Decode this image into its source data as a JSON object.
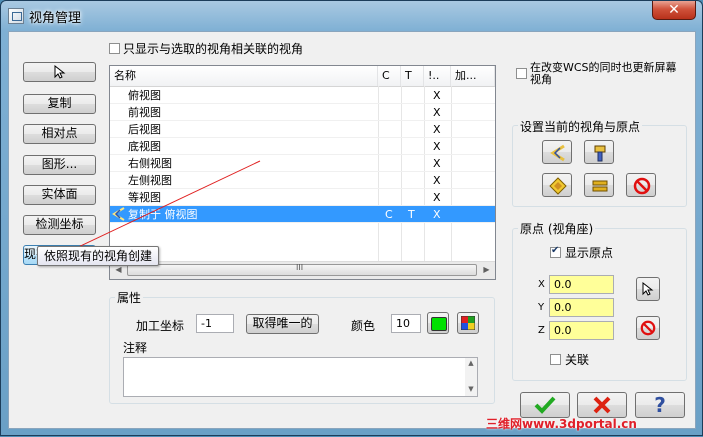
{
  "window": {
    "title": "视角管理",
    "close_label": "✕"
  },
  "left_buttons": [
    {
      "label": ""
    },
    {
      "label": "复制"
    },
    {
      "label": "相对点"
    },
    {
      "label": "图形..."
    },
    {
      "label": "实体面"
    },
    {
      "label": "检测坐标"
    },
    {
      "label": "现有的视角创"
    }
  ],
  "tooltip": "依照现有的视角创建",
  "filter_checkbox": {
    "label": "只显示与选取的视角相关联的视角",
    "checked": false
  },
  "list": {
    "headers": [
      "名称",
      "C",
      "T",
      "!..",
      "加..."
    ],
    "rows": [
      {
        "name": "俯视图",
        "c": "",
        "t": "",
        "x": "X",
        "selected": false
      },
      {
        "name": "前视图",
        "c": "",
        "t": "",
        "x": "X",
        "selected": false
      },
      {
        "name": "后视图",
        "c": "",
        "t": "",
        "x": "X",
        "selected": false
      },
      {
        "name": "底视图",
        "c": "",
        "t": "",
        "x": "X",
        "selected": false
      },
      {
        "name": "右侧视图",
        "c": "",
        "t": "",
        "x": "X",
        "selected": false
      },
      {
        "name": "左侧视图",
        "c": "",
        "t": "",
        "x": "X",
        "selected": false
      },
      {
        "name": "等视图",
        "c": "",
        "t": "",
        "x": "X",
        "selected": false
      },
      {
        "name": "复制于 俯视图",
        "c": "C",
        "t": "T",
        "x": "X",
        "selected": true
      }
    ],
    "scroll_left": "◀",
    "scroll_right": "▶",
    "thumb_grip": "III"
  },
  "props": {
    "group_title": "属性",
    "wcs_label": "加工坐标",
    "wcs_value": "-1",
    "unique_button": "取得唯一的",
    "color_label": "颜色",
    "color_value": "10",
    "notes_label": "注释",
    "notes_value": "",
    "color_green": "#00e000"
  },
  "right": {
    "update_checkbox": {
      "label_line1": "在改变WCS的同时也更新屏幕",
      "label_line2": "视角",
      "checked": false
    },
    "set_group_title": "设置当前的视角与原点",
    "origin_group_title": "原点 (视角座)",
    "show_origin": {
      "label": "显示原点",
      "checked": true
    },
    "x_label": "X",
    "x_value": "0.0",
    "y_label": "Y",
    "y_value": "0.0",
    "z_label": "Z",
    "z_value": "0.0",
    "link": {
      "label": "关联",
      "checked": false
    }
  },
  "bottom": {
    "ok_color": "#22aa22",
    "cancel_color": "#dd2211",
    "help_label": "?"
  },
  "watermark": "三维网www.3dportal.cn"
}
